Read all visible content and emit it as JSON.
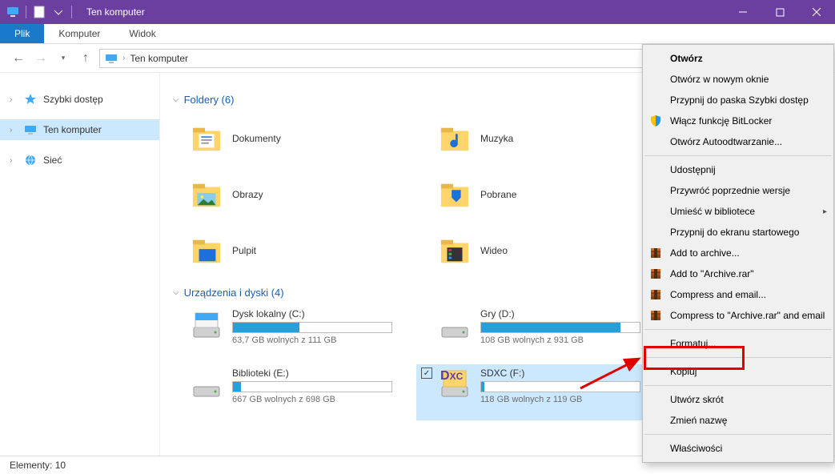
{
  "titlebar": {
    "title": "Ten komputer"
  },
  "ribbon": {
    "tabs": [
      "Plik",
      "Komputer",
      "Widok"
    ]
  },
  "address": {
    "path": "Ten komputer"
  },
  "sidebar": {
    "items": [
      {
        "label": "Szybki dostęp"
      },
      {
        "label": "Ten komputer"
      },
      {
        "label": "Sieć"
      }
    ]
  },
  "groups": {
    "folders": {
      "title": "Foldery (6)"
    },
    "drives": {
      "title": "Urządzenia i dyski (4)"
    }
  },
  "folders": [
    {
      "label": "Dokumenty"
    },
    {
      "label": "Muzyka"
    },
    {
      "label": "Obrazy"
    },
    {
      "label": "Pobrane"
    },
    {
      "label": "Pulpit"
    },
    {
      "label": "Wideo"
    }
  ],
  "drives": [
    {
      "name": "Dysk lokalny (C:)",
      "free": "63,7 GB wolnych z 111 GB",
      "fill": 42
    },
    {
      "name": "Gry (D:)",
      "free": "108 GB wolnych z 931 GB",
      "fill": 88
    },
    {
      "name": "Biblioteki (E:)",
      "free": "667 GB wolnych z 698 GB",
      "fill": 5
    },
    {
      "name": "SDXC (F:)",
      "free": "118 GB wolnych z 119 GB",
      "fill": 2
    }
  ],
  "context": {
    "items": [
      "Otwórz",
      "Otwórz w nowym oknie",
      "Przypnij do paska Szybki dostęp",
      "Włącz funkcję BitLocker",
      "Otwórz Autoodtwarzanie...",
      "-",
      "Udostępnij",
      "Przywróć poprzednie wersje",
      "Umieść w bibliotece",
      "Przypnij do ekranu startowego",
      "Add to archive...",
      "Add to \"Archive.rar\"",
      "Compress and email...",
      "Compress to \"Archive.rar\" and email",
      "-",
      "Formatuj...",
      "-",
      "Kopiuj",
      "-",
      "Utwórz skrót",
      "Zmień nazwę",
      "-",
      "Właściwości"
    ]
  },
  "status": {
    "text": "Elementy: 10"
  }
}
